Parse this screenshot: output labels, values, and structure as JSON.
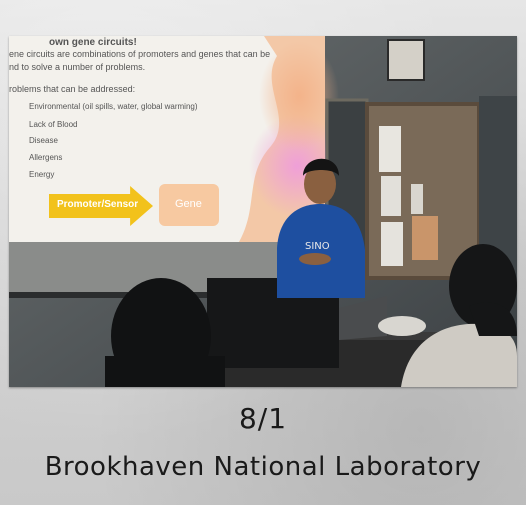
{
  "caption": {
    "date": "8/1",
    "place": "Brookhaven National Laboratory"
  },
  "slide": {
    "heading": "own gene circuits!",
    "intro_line1": "ene circuits are combinations of promoters and genes that can be",
    "intro_line2": "nd to solve a number of problems.",
    "problems_heading": "roblems that can be addressed:",
    "bullets": [
      "Environmental (oil spills, water, global warming)",
      "Lack of Blood",
      "Disease",
      "Allergens",
      "Energy"
    ],
    "promoter_label": "Promoter/Sensor",
    "gene_label": "Gene"
  },
  "colors": {
    "border": "#d6d6d6",
    "slide_bg": "#f4f2ee",
    "arrow": "#f2c21b",
    "gene_box": "#f7c9a1",
    "shirt": "#1e4fa0",
    "wall": "#545a5e"
  }
}
